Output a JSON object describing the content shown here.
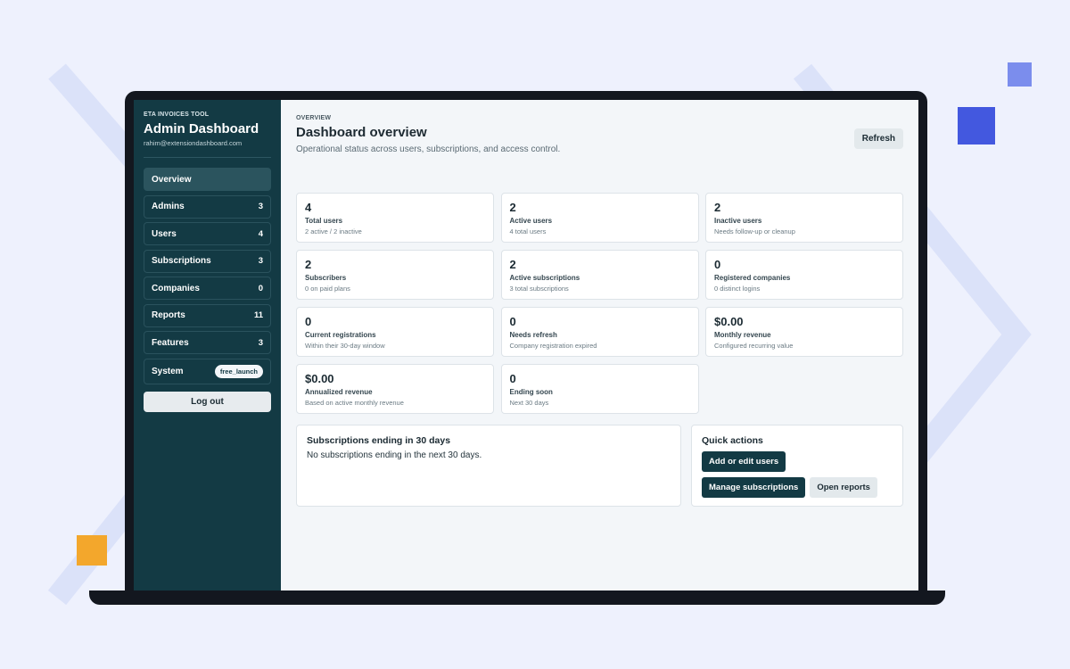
{
  "colors": {
    "background": "#eef1fd",
    "sidebar": "#133a44",
    "accent_blue": "#4358df",
    "accent_light_blue": "#7b8ded",
    "accent_orange": "#f3a72c",
    "chevron": "#dbe2f9"
  },
  "sidebar": {
    "kicker": "ETA INVOICES TOOL",
    "title": "Admin Dashboard",
    "email": "rahim@extensiondashboard.com",
    "items": [
      {
        "label": "Overview",
        "count": ""
      },
      {
        "label": "Admins",
        "count": "3"
      },
      {
        "label": "Users",
        "count": "4"
      },
      {
        "label": "Subscriptions",
        "count": "3"
      },
      {
        "label": "Companies",
        "count": "0"
      },
      {
        "label": "Reports",
        "count": "11"
      },
      {
        "label": "Features",
        "count": "3"
      }
    ],
    "system": {
      "label": "System",
      "badge": "free_launch"
    },
    "logout_label": "Log out"
  },
  "header": {
    "kicker": "OVERVIEW",
    "title": "Dashboard overview",
    "subtitle": "Operational status across users, subscriptions, and access control.",
    "refresh_label": "Refresh"
  },
  "cards": [
    {
      "value": "4",
      "label": "Total users",
      "sub": "2 active / 2 inactive"
    },
    {
      "value": "2",
      "label": "Active users",
      "sub": "4 total users"
    },
    {
      "value": "2",
      "label": "Inactive users",
      "sub": "Needs follow-up or cleanup"
    },
    {
      "value": "2",
      "label": "Subscribers",
      "sub": "0 on paid plans"
    },
    {
      "value": "2",
      "label": "Active subscriptions",
      "sub": "3 total subscriptions"
    },
    {
      "value": "0",
      "label": "Registered companies",
      "sub": "0 distinct logins"
    },
    {
      "value": "0",
      "label": "Current registrations",
      "sub": "Within their 30-day window"
    },
    {
      "value": "0",
      "label": "Needs refresh",
      "sub": "Company registration expired"
    },
    {
      "value": "$0.00",
      "label": "Monthly revenue",
      "sub": "Configured recurring value"
    },
    {
      "value": "$0.00",
      "label": "Annualized revenue",
      "sub": "Based on active monthly revenue"
    },
    {
      "value": "0",
      "label": "Ending soon",
      "sub": "Next 30 days"
    }
  ],
  "ending_panel": {
    "title": "Subscriptions ending in 30 days",
    "text": "No subscriptions ending in the next 30 days."
  },
  "quick_actions": {
    "title": "Quick actions",
    "add_users": "Add or edit users",
    "manage_subscriptions": "Manage subscriptions",
    "open_reports": "Open reports"
  }
}
